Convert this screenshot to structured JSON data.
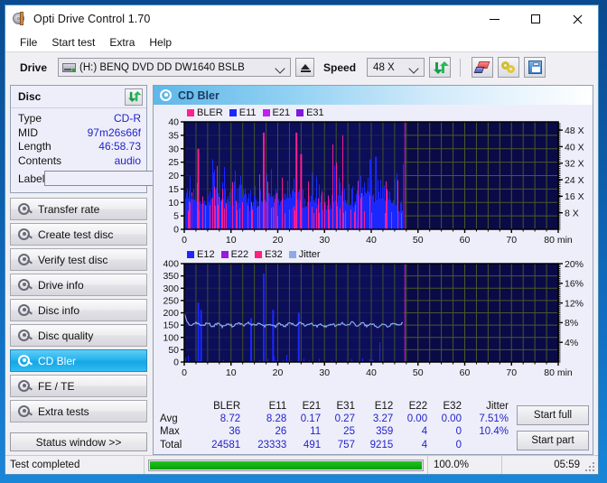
{
  "window": {
    "title": "Opti Drive Control 1.70",
    "icon": "optical-disc-icon",
    "controls": {
      "minimize": "—",
      "maximize": "▢",
      "close": "✕"
    }
  },
  "menu": {
    "items": [
      "File",
      "Start test",
      "Extra",
      "Help"
    ]
  },
  "toolbar": {
    "drive_label": "Drive",
    "drive_value": "(H:)   BENQ DVD DD DW1640 BSLB",
    "eject_title": "Eject",
    "speed_label": "Speed",
    "speed_value": "48 X",
    "refresh_title": "Refresh",
    "erase_title": "Erase",
    "key_title": "Key",
    "save_title": "Save"
  },
  "disc_panel": {
    "header": "Disc",
    "refresh_icon": "refresh-icon",
    "rows": [
      {
        "key": "Type",
        "value": "CD-R"
      },
      {
        "key": "MID",
        "value": "97m26s66f"
      },
      {
        "key": "Length",
        "value": "46:58.73"
      },
      {
        "key": "Contents",
        "value": "audio"
      }
    ],
    "label_key": "Label",
    "label_value": "",
    "label_placeholder": ""
  },
  "sidebar": {
    "items": [
      {
        "label": "Transfer rate",
        "active": false
      },
      {
        "label": "Create test disc",
        "active": false
      },
      {
        "label": "Verify test disc",
        "active": false
      },
      {
        "label": "Drive info",
        "active": false
      },
      {
        "label": "Disc info",
        "active": false
      },
      {
        "label": "Disc quality",
        "active": false
      },
      {
        "label": "CD Bler",
        "active": true
      },
      {
        "label": "FE / TE",
        "active": false
      },
      {
        "label": "Extra tests",
        "active": false
      }
    ],
    "status_window_button": "Status window >>"
  },
  "content": {
    "header": "CD Bler",
    "header_icon": "disc-test-icon"
  },
  "stats": {
    "columns": [
      "BLER",
      "E11",
      "E21",
      "E31",
      "E12",
      "E22",
      "E32",
      "Jitter"
    ],
    "rows": [
      {
        "label": "Avg",
        "values": [
          "8.72",
          "8.28",
          "0.17",
          "0.27",
          "3.27",
          "0.00",
          "0.00",
          "7.51%"
        ]
      },
      {
        "label": "Max",
        "values": [
          "36",
          "26",
          "11",
          "25",
          "359",
          "4",
          "0",
          "10.4%"
        ]
      },
      {
        "label": "Total",
        "values": [
          "24581",
          "23333",
          "491",
          "757",
          "9215",
          "4",
          "0",
          ""
        ]
      }
    ],
    "start_full": "Start full",
    "start_part": "Start part"
  },
  "statusbar": {
    "message": "Test completed",
    "progress_percent": "100.0%",
    "progress_value": 100,
    "elapsed": "05:59"
  },
  "colors": {
    "bler": "#ff1f8f",
    "e11": "#1a28ff",
    "e21": "#b018e8",
    "e31": "#7a18d8",
    "e12": "#1a28ff",
    "e22": "#9a18e0",
    "e32": "#ff1f7f",
    "jitter": "#8fa8e8",
    "plot_bg": "#0a0a46",
    "grid": "#5a6a2a",
    "accent": "#28b3ee",
    "progress": "#0a9e0a"
  },
  "chart_data": [
    {
      "type": "area",
      "name": "cd-bler-top",
      "title": "",
      "xlabel": "min",
      "ylabel": "",
      "xlim": [
        0,
        80
      ],
      "ylim": [
        0,
        40
      ],
      "yticks": [
        0,
        5,
        10,
        15,
        20,
        25,
        30,
        35,
        40
      ],
      "xticks": [
        0,
        10,
        20,
        30,
        40,
        50,
        60,
        70,
        80
      ],
      "y2label": "X",
      "y2lim": [
        0,
        52
      ],
      "y2ticks": [
        "8 X",
        "16 X",
        "24 X",
        "32 X",
        "40 X",
        "48 X"
      ],
      "grid": true,
      "legend": [
        "BLER",
        "E11",
        "E21",
        "E31"
      ],
      "legend_position": "top-left",
      "data_end_min": 47,
      "series": [
        {
          "name": "BLER",
          "color": "#ff1f8f",
          "avg": 8.72,
          "max": 36,
          "total": 24581
        },
        {
          "name": "E11",
          "color": "#1a28ff",
          "avg": 8.28,
          "max": 26,
          "total": 23333
        },
        {
          "name": "E21",
          "color": "#b018e8",
          "avg": 0.17,
          "max": 11,
          "total": 491
        },
        {
          "name": "E31",
          "color": "#7a18d8",
          "avg": 0.27,
          "max": 25,
          "total": 757
        }
      ],
      "notable_peaks": [
        {
          "x": 17,
          "y": 36,
          "series": "BLER"
        },
        {
          "x": 24,
          "y": 36,
          "series": "BLER"
        },
        {
          "x": 3,
          "y": 30,
          "series": "BLER"
        },
        {
          "x": 25,
          "y": 28,
          "series": "BLER"
        },
        {
          "x": 41,
          "y": 27,
          "series": "E11"
        }
      ]
    },
    {
      "type": "line",
      "name": "cd-bler-bottom",
      "title": "",
      "xlabel": "min",
      "ylabel": "",
      "xlim": [
        0,
        80
      ],
      "ylim": [
        0,
        400
      ],
      "yticks": [
        0,
        50,
        100,
        150,
        200,
        250,
        300,
        350,
        400
      ],
      "xticks": [
        0,
        10,
        20,
        30,
        40,
        50,
        60,
        70,
        80
      ],
      "y2lim": [
        0,
        20
      ],
      "y2ticks": [
        "4%",
        "8%",
        "12%",
        "16%",
        "20%"
      ],
      "grid": true,
      "legend": [
        "E12",
        "E22",
        "E32",
        "Jitter"
      ],
      "legend_position": "top-left",
      "data_end_min": 47,
      "series": [
        {
          "name": "E12",
          "color": "#1a28ff",
          "avg": 3.27,
          "max": 359,
          "total": 9215
        },
        {
          "name": "E22",
          "color": "#9a18e0",
          "avg": 0.0,
          "max": 4,
          "total": 4
        },
        {
          "name": "E32",
          "color": "#ff1f7f",
          "avg": 0.0,
          "max": 0,
          "total": 0
        },
        {
          "name": "Jitter",
          "color": "#8fa8e8",
          "avg": 7.51,
          "max": 10.4,
          "unit": "%"
        }
      ],
      "jitter_baseline_percent": 7.6,
      "notable_peaks": [
        {
          "x": 17,
          "y": 359,
          "series": "E12"
        },
        {
          "x": 3,
          "y": 242,
          "series": "E12"
        },
        {
          "x": 3.6,
          "y": 211,
          "series": "E12"
        },
        {
          "x": 19,
          "y": 212,
          "series": "E12"
        },
        {
          "x": 24.5,
          "y": 200,
          "series": "E12"
        },
        {
          "x": 14.3,
          "y": 178,
          "series": "E12"
        }
      ]
    }
  ]
}
